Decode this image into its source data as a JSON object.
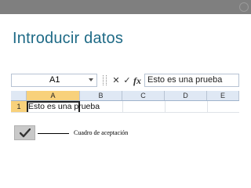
{
  "slide": {
    "title": "Introducir datos"
  },
  "excel": {
    "name_box": "A1",
    "formula_buttons": {
      "cancel": "✕",
      "enter": "✓",
      "fx": "fx"
    },
    "formula_bar_value": "Esto es una prueba",
    "columns": [
      "A",
      "B",
      "C",
      "D",
      "E"
    ],
    "rows": [
      {
        "number": "1",
        "A": "Esto es una prueba"
      }
    ],
    "colors": {
      "header_bg": "#dfe8f4",
      "selected_header": "#f8d17b"
    }
  },
  "annotation": {
    "caption": "Cuadro de aceptación",
    "icon": "check-icon"
  },
  "colors": {
    "title": "#1e6a86",
    "topbar": "#7f7f7f"
  }
}
